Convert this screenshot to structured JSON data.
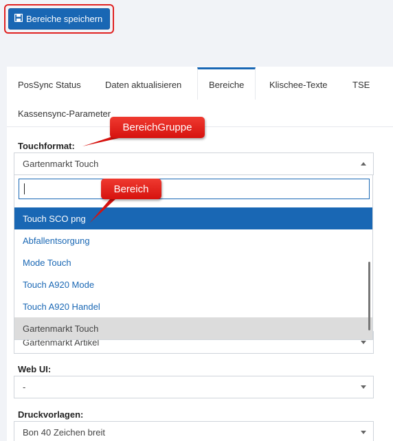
{
  "toolbar": {
    "save_label": "Bereiche speichern"
  },
  "tabs": [
    {
      "label": "PosSync Status"
    },
    {
      "label": "Daten aktualisieren"
    },
    {
      "label": "Bereiche"
    },
    {
      "label": "Klischee-Texte"
    },
    {
      "label": "TSE"
    },
    {
      "label": "Kassensync-Parameter"
    }
  ],
  "active_tab": "Bereiche",
  "form": {
    "touchformat_label": "Touchformat:",
    "touchformat_value": "Gartenmarkt Touch",
    "hidden_select_value": "Gartenmarkt Artikel",
    "webui_label": "Web UI:",
    "webui_value": "-",
    "druck_label": "Druckvorlagen:",
    "druck_value": "Bon 40 Zeichen breit"
  },
  "dropdown": {
    "search_value": "",
    "items": [
      {
        "label": "Touch SCO png",
        "state": "highlighted"
      },
      {
        "label": "Abfallentsorgung",
        "state": ""
      },
      {
        "label": "Mode Touch",
        "state": ""
      },
      {
        "label": "Touch A920 Mode",
        "state": ""
      },
      {
        "label": "Touch A920 Handel",
        "state": ""
      },
      {
        "label": "Gartenmarkt Touch",
        "state": "selected"
      }
    ]
  },
  "annotations": {
    "callout_1": "BereichGruppe",
    "callout_2": "Bereich"
  },
  "colors": {
    "accent": "#1967b4",
    "callout": "#e8201c",
    "background": "#f1f3f7"
  }
}
